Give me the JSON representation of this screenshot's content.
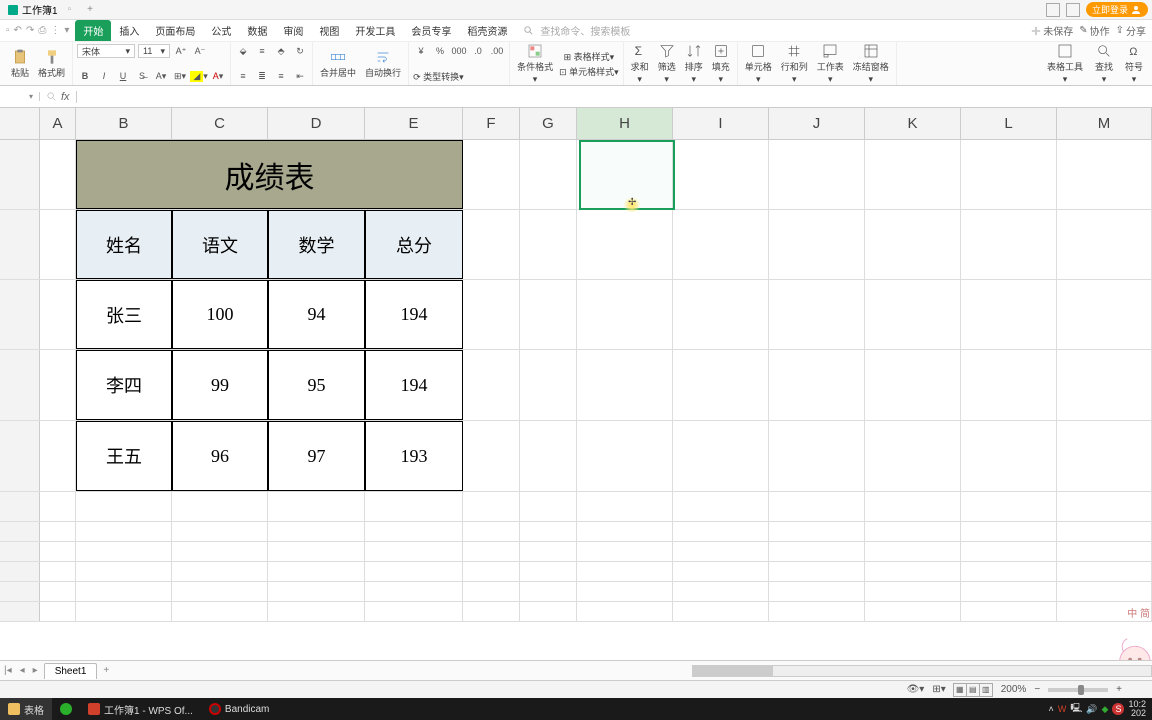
{
  "titlebar": {
    "filename": "工作簿1",
    "login": "立即登录"
  },
  "menubar": {
    "tabs": [
      "开始",
      "插入",
      "页面布局",
      "公式",
      "数据",
      "审阅",
      "视图",
      "开发工具",
      "会员专享",
      "稻壳资源"
    ],
    "search_ph": "查找命令、搜索模板",
    "unsaved": "未保存",
    "coop": "协作",
    "share": "分享"
  },
  "ribbon": {
    "paste": "粘贴",
    "format_painter": "格式刷",
    "font_name": "宋体",
    "font_size": "11",
    "merge_center": "合并居中",
    "wrap": "自动换行",
    "type_convert": "类型转换",
    "cond_fmt": "条件格式",
    "cell_style": "单元格样式",
    "sum": "求和",
    "filter": "筛选",
    "sort": "排序",
    "fill": "填充",
    "cells": "单元格",
    "rowcol": "行和列",
    "sheet": "工作表",
    "freeze": "冻结窗格",
    "table_tool": "表格工具",
    "find": "查找",
    "symbol": "符号",
    "currency": "¥",
    "percent": "%",
    "thousand": "000",
    "dec1": ".0",
    "dec2": ".00"
  },
  "formulabar": {
    "fx": "fx"
  },
  "columns": [
    {
      "l": "A",
      "w": 36
    },
    {
      "l": "B",
      "w": 96
    },
    {
      "l": "C",
      "w": 96
    },
    {
      "l": "D",
      "w": 97
    },
    {
      "l": "E",
      "w": 98
    },
    {
      "l": "F",
      "w": 57
    },
    {
      "l": "G",
      "w": 57
    },
    {
      "l": "H",
      "w": 96
    },
    {
      "l": "I",
      "w": 96
    },
    {
      "l": "J",
      "w": 96
    },
    {
      "l": "K",
      "w": 96
    },
    {
      "l": "L",
      "w": 96
    },
    {
      "l": "M",
      "w": 95
    }
  ],
  "chart_data": {
    "type": "table",
    "title": "成绩表",
    "headers": [
      "姓名",
      "语文",
      "数学",
      "总分"
    ],
    "rows": [
      {
        "name": "张三",
        "chinese": 100,
        "math": 94,
        "total": 194
      },
      {
        "name": "李四",
        "chinese": 99,
        "math": 95,
        "total": 194
      },
      {
        "name": "王五",
        "chinese": 96,
        "math": 97,
        "total": 193
      }
    ]
  },
  "sheet": {
    "name": "Sheet1"
  },
  "statusbar": {
    "zoom": "200%"
  },
  "assistant": {
    "lang": "中 简"
  },
  "taskbar": {
    "folder": "表格",
    "wps": "工作簿1 - WPS Of...",
    "bandicam": "Bandicam",
    "time": "10:2",
    "date": "202"
  }
}
